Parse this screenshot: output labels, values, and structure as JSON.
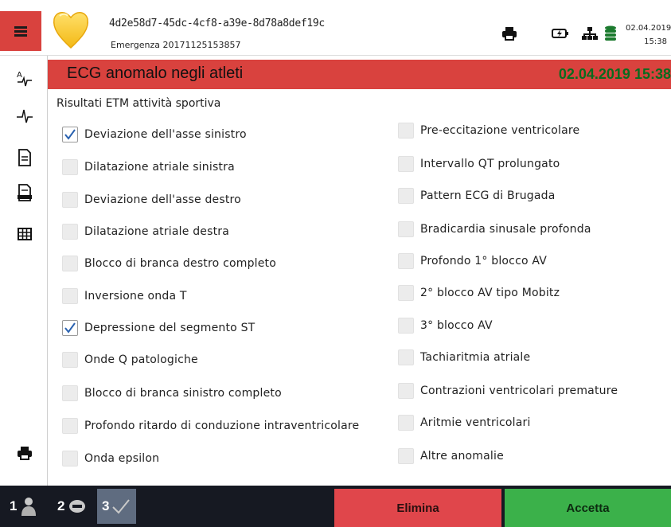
{
  "header": {
    "case_id": "4d2e58d7-45dc-4cf8-a39e-8d78a8def19c",
    "emergency_label": "Emergenza 20171125153857",
    "date": "02.04.2019",
    "time": "15:38",
    "icons": [
      "menu-icon",
      "heart-logo",
      "printer-icon",
      "battery-charging-icon",
      "network-icon",
      "database-icon"
    ]
  },
  "sidebar": {
    "icons": [
      "ecg-analysis-icon",
      "ecg-wave-icon",
      "document-icon",
      "sport-report-icon",
      "table-grid-icon",
      "printer-icon"
    ]
  },
  "title": {
    "text": "ECG anomalo negli atleti",
    "datetime": "02.04.2019 15:38"
  },
  "section_label": "Risultati ETM attività sportiva",
  "left_items": [
    {
      "label": "Deviazione dell'asse sinistro",
      "checked": true
    },
    {
      "label": "Dilatazione atriale sinistra",
      "checked": false
    },
    {
      "label": "Deviazione dell'asse destro",
      "checked": false
    },
    {
      "label": "Dilatazione atriale destra",
      "checked": false
    },
    {
      "label": "Blocco di branca destro completo",
      "checked": false
    },
    {
      "label": "Inversione onda T",
      "checked": false
    },
    {
      "label": "Depressione del segmento ST",
      "checked": true
    },
    {
      "label": "Onde Q patologiche",
      "checked": false
    },
    {
      "label": "Blocco di branca sinistro completo",
      "checked": false
    },
    {
      "label": "Profondo ritardo di conduzione intraventricolare",
      "checked": false
    },
    {
      "label": "Onda epsilon",
      "checked": false
    }
  ],
  "right_items": [
    {
      "label": "Pre-eccitazione ventricolare",
      "checked": false
    },
    {
      "label": "Intervallo QT prolungato",
      "checked": false
    },
    {
      "label": "Pattern ECG di Brugada",
      "checked": false
    },
    {
      "label": "Bradicardia sinusale profonda",
      "checked": false
    },
    {
      "label": "Profondo 1° blocco AV",
      "checked": false
    },
    {
      "label": "2° blocco AV tipo Mobitz",
      "checked": false
    },
    {
      "label": "3° blocco AV",
      "checked": false
    },
    {
      "label": "Tachiaritmia atriale",
      "checked": false
    },
    {
      "label": "Contrazioni ventricolari premature",
      "checked": false
    },
    {
      "label": "Aritmie ventricolari",
      "checked": false
    },
    {
      "label": "Altre anomalie",
      "checked": false
    }
  ],
  "footer": {
    "steps": [
      {
        "number": "1",
        "icon": "patient-icon"
      },
      {
        "number": "2",
        "icon": "vehicle-icon"
      },
      {
        "number": "3",
        "icon": "checkmark-icon"
      }
    ],
    "delete_label": "Elimina",
    "accept_label": "Accetta"
  },
  "colors": {
    "accent_red": "#d9423e",
    "date_green": "#0a6b1e",
    "footer_bg": "#161922",
    "delete_bg": "#e0464b",
    "accept_bg": "#3bb14a"
  }
}
